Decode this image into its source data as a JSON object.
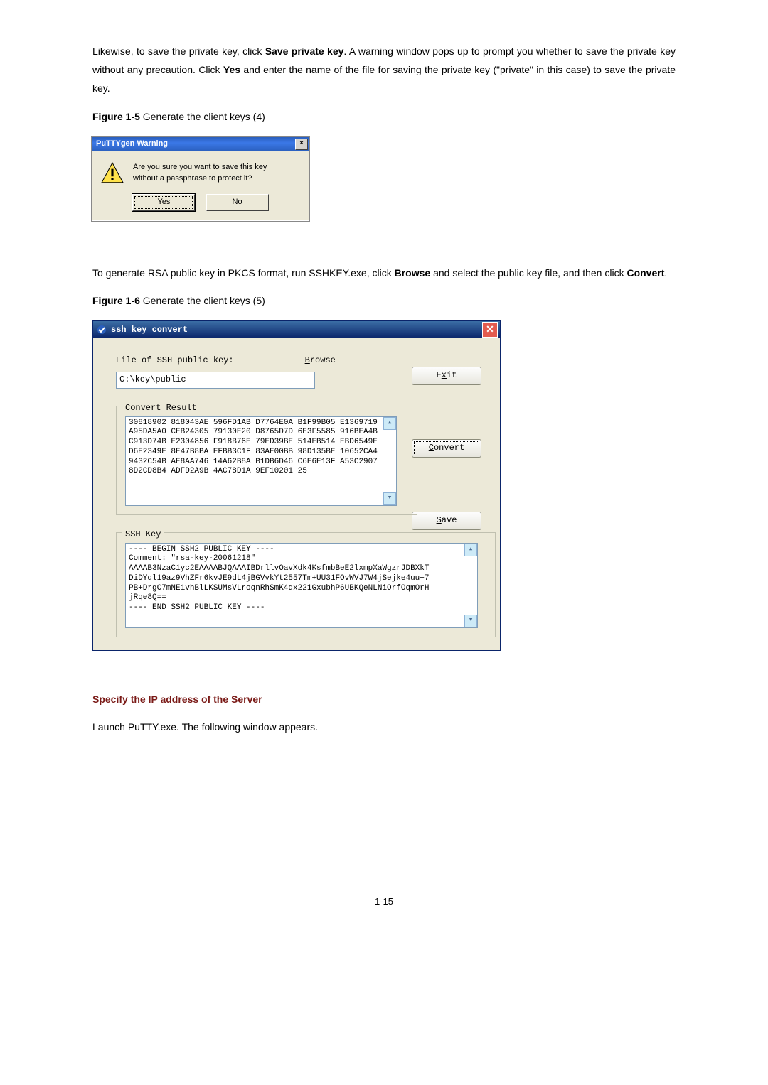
{
  "para1_pre": "Likewise, to save the private key, click ",
  "para1_b1": "Save private key",
  "para1_mid": ". A warning window pops up to prompt you whether to save the private key without any precaution. Click ",
  "para1_b2": "Yes",
  "para1_post": " and enter the name of the file for saving the private key (\"private\" in this case) to save the private key.",
  "fig5_b": "Figure 1-5 ",
  "fig5_t": "Generate the client keys (4)",
  "warn": {
    "title": "PuTTYgen Warning",
    "msg": "Are you sure you want to save this key\nwithout a passphrase to protect it?",
    "yes_u": "Y",
    "yes_rest": "es",
    "no_u": "N",
    "no_rest": "o",
    "x": "×"
  },
  "para2_pre": "To generate RSA public key in PKCS format, run SSHKEY.exe, click ",
  "para2_b1": "Browse",
  "para2_mid": " and select the public key file, and then click ",
  "para2_b2": "Convert",
  "para2_post": ".",
  "fig6_b": "Figure 1-6 ",
  "fig6_t": "Generate the client keys (5)",
  "conv": {
    "title": "ssh key convert",
    "file_label": "File of SSH public key:",
    "browse_u": "B",
    "browse_rest": "rowse",
    "file_value": "C:\\key\\public",
    "exit_pre": "E",
    "exit_u": "x",
    "exit_post": "it",
    "legend_result": "Convert Result",
    "convert_u": "C",
    "convert_rest": "onvert",
    "save_u": "S",
    "save_rest": "ave",
    "result_text": "30818902 818043AE 596FD1AB D7764E0A B1F99B05 E1369719\nA95DA5A0 CEB24305 79130E20 D8765D7D 6E3F5585 916BEA4B\nC913D74B E2304856 F918B76E 79ED39BE 514EB514 EBD6549E\nD6E2349E 8E47B8BA EFBB3C1F 83AE00BB 98D135BE 10652CA4\n9432C54B AE8AA746 14A62B8A B1DB6D46 C6E6E13F A53C2907\n8D2CD8B4 ADFD2A9B 4AC78D1A 9EF10201 25",
    "legend_ssh": "SSH Key",
    "ssh_text": "---- BEGIN SSH2 PUBLIC KEY ----\nComment: \"rsa-key-20061218\"\nAAAAB3NzaC1yc2EAAAABJQAAAIBDrllvOavXdk4KsfmbBeE2lxmpXaWgzrJDBXkT\nDiDYdl19az9VhZFr6kvJE9dL4jBGVvkYt2557Tm+UU31FOvWVJ7W4jSejke4uu+7\nPB+DrgC7mNE1vhBlLKSUMsVLroqnRhSmK4qx221GxubhP6UBKQeNLNiOrfOqmOrH\njRqe8Q==\n---- END SSH2 PUBLIC KEY ----"
  },
  "section_hdr": "Specify the IP address of the Server",
  "para3": "Launch PuTTY.exe. The following window appears.",
  "page_no": "1-15"
}
